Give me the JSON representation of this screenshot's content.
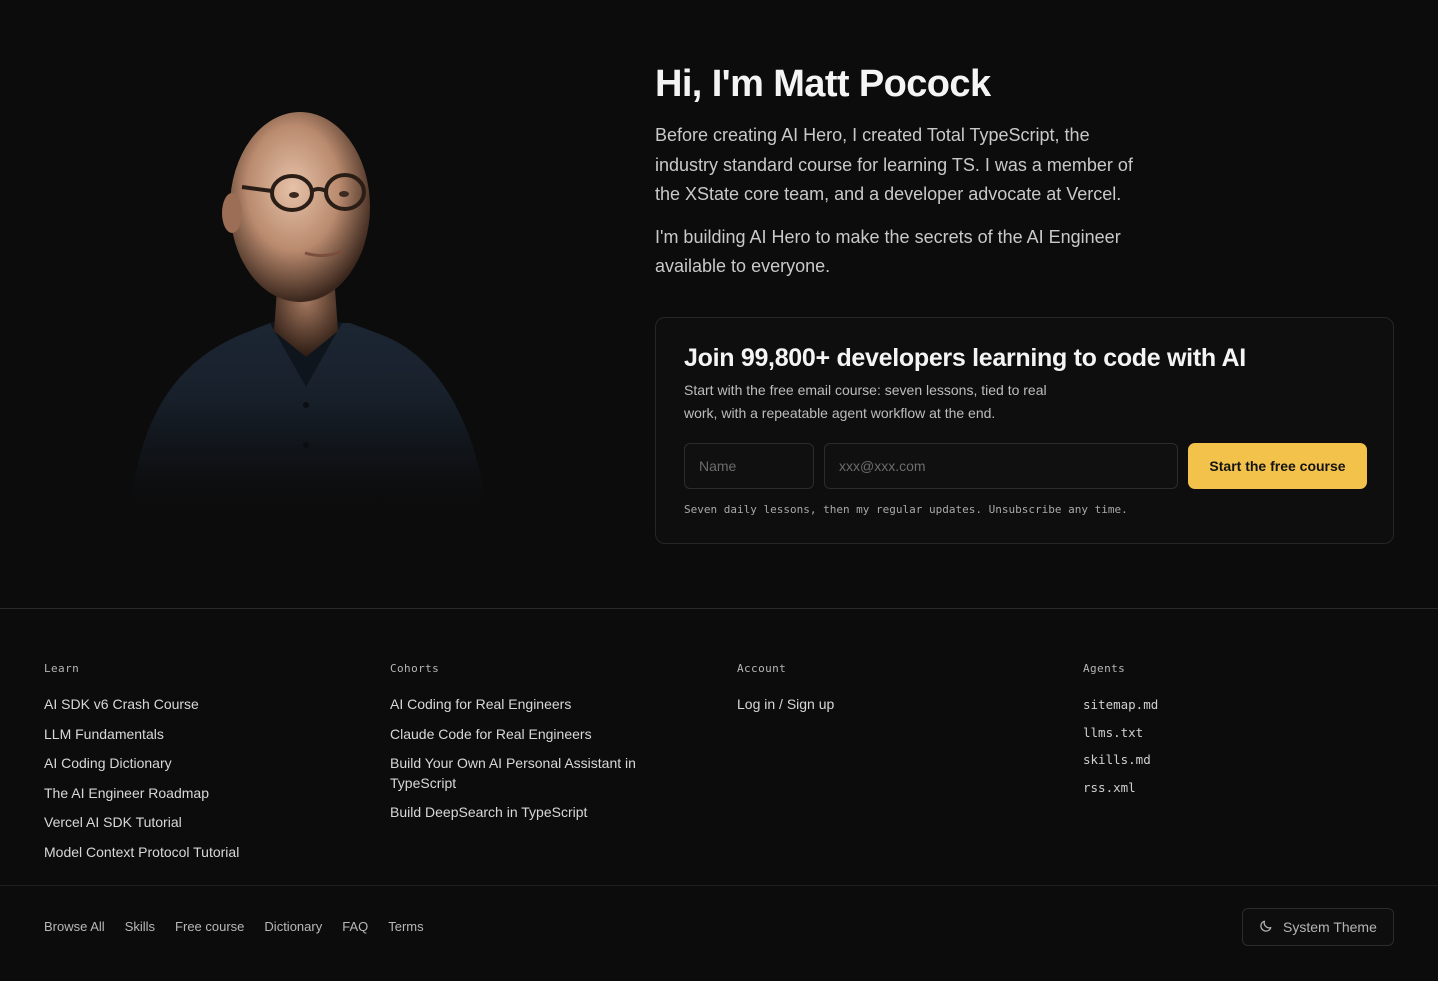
{
  "hero": {
    "heading": "Hi, I'm Matt Pocock",
    "paragraph1": "Before creating AI Hero, I created Total TypeScript, the industry standard course for learning TS. I was a member of the XState core team, and a developer advocate at Vercel.",
    "paragraph2": "I'm building AI Hero to make the secrets of the AI Engineer available to everyone."
  },
  "signup": {
    "heading": "Join 99,800+ developers learning to code with AI",
    "description": "Start with the free email course: seven lessons, tied to real work, with a repeatable agent workflow at the end.",
    "name_placeholder": "Name",
    "email_placeholder": "xxx@xxx.com",
    "button_label": "Start the free course",
    "fineprint": "Seven daily lessons, then my regular updates. Unsubscribe any time.",
    "button_color": "#f3c24b"
  },
  "footer": {
    "columns": [
      {
        "title": "Learn",
        "links": [
          "AI SDK v6 Crash Course",
          "LLM Fundamentals",
          "AI Coding Dictionary",
          "The AI Engineer Roadmap",
          "Vercel AI SDK Tutorial",
          "Model Context Protocol Tutorial"
        ]
      },
      {
        "title": "Cohorts",
        "links": [
          "AI Coding for Real Engineers",
          "Claude Code for Real Engineers",
          "Build Your Own AI Personal Assistant in TypeScript",
          "Build DeepSearch in TypeScript"
        ]
      },
      {
        "title": "Account",
        "links": [
          "Log in / Sign up"
        ]
      },
      {
        "title": "Agents",
        "links": [
          "sitemap.md",
          "llms.txt",
          "skills.md",
          "rss.xml"
        ]
      }
    ],
    "bottom_links": [
      "Browse All",
      "Skills",
      "Free course",
      "Dictionary",
      "FAQ",
      "Terms"
    ],
    "theme_button": {
      "label": "System Theme",
      "icon": "moon-icon"
    }
  },
  "colors": {
    "background": "#0c0c0c",
    "accent": "#f3c24b"
  }
}
